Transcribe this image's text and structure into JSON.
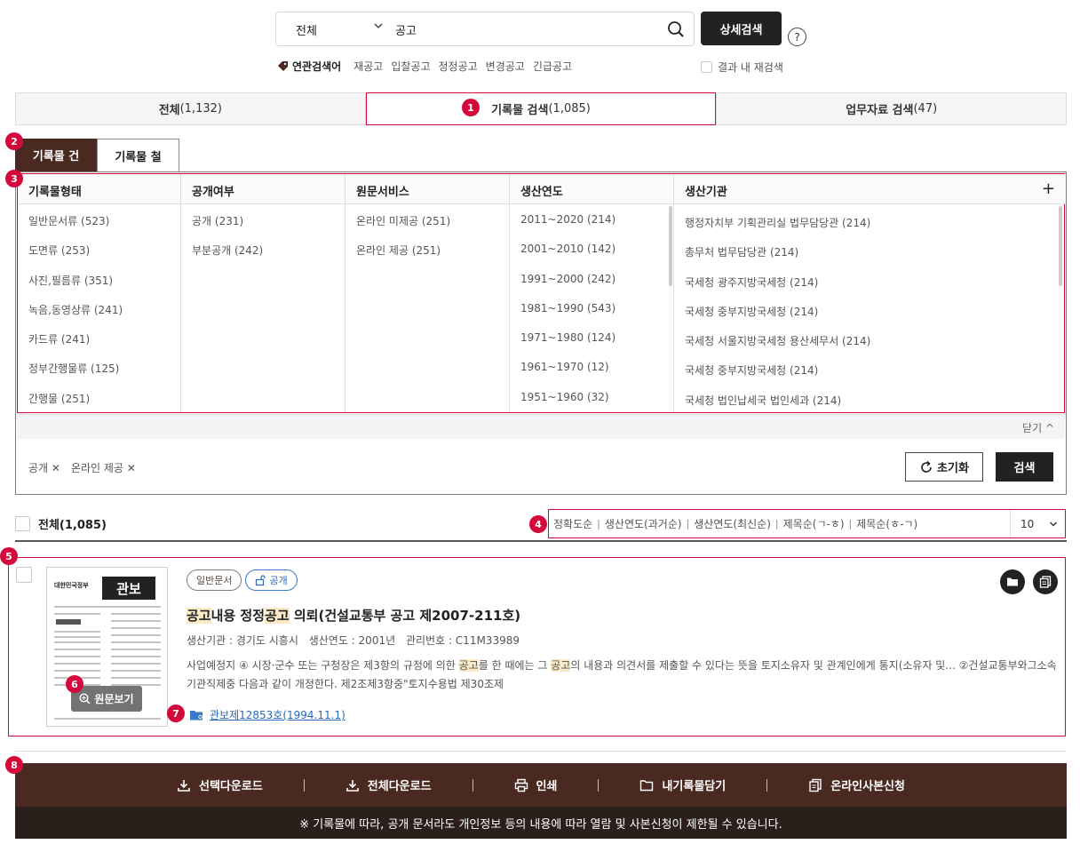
{
  "search": {
    "scope": "전체",
    "query": "공고",
    "advanced_label": "상세검색",
    "help_label": "?"
  },
  "related": {
    "label": "연관검색어",
    "keywords": [
      "재공고",
      "입찰공고",
      "정정공고",
      "변경공고",
      "긴급공고"
    ],
    "within_label": "결과 내 재검색"
  },
  "tabs": [
    {
      "label": "전체",
      "count": "(1,132)"
    },
    {
      "label": "기록물 검색",
      "count": "(1,085)"
    },
    {
      "label": "업무자료 검색",
      "count": "(47)"
    }
  ],
  "subtabs": [
    "기록물 건",
    "기록물 철"
  ],
  "markers": [
    "1",
    "2",
    "3",
    "4",
    "5",
    "6",
    "7",
    "8"
  ],
  "filters": {
    "columns": [
      {
        "header": "기록물형태",
        "items": [
          "일반문서류 (523)",
          "도면류 (253)",
          "사진,필름류 (351)",
          "녹음,동영상류 (241)",
          "카드류 (241)",
          "정부간행물류 (125)",
          "간행물 (251)"
        ]
      },
      {
        "header": "공개여부",
        "items": [
          "공개 (231)",
          "부분공개 (242)"
        ]
      },
      {
        "header": "원문서비스",
        "items": [
          "온라인 미제공 (251)",
          "온라인 제공 (251)"
        ]
      },
      {
        "header": "생산연도",
        "items": [
          "2011~2020 (214)",
          "2001~2010 (142)",
          "1991~2000 (242)",
          "1981~1990 (543)",
          "1971~1980 (124)",
          "1961~1970 (12)",
          "1951~1960 (32)"
        ]
      },
      {
        "header": "생산기관",
        "items": [
          "행정자치부 기획관리실 법무담당관 (214)",
          "총무처 법무담당관 (214)",
          "국세청 광주지방국세청 (214)",
          "국세청 중부지방국세청 (214)",
          "국세청 서울지방국세청 용산세무서 (214)",
          "국세청 중부지방국세청 (214)",
          "국세청 법인납세국 법인세과 (214)"
        ]
      }
    ],
    "plus": "+",
    "close_label": "닫기 ^",
    "chips": [
      "공개 ✕",
      "온라인 제공 ✕"
    ],
    "reset_label": "초기화",
    "search_label": "검색"
  },
  "results_header": {
    "all_label": "전체(1,085)",
    "sorts": [
      "정확도순",
      "생산연도(과거순)",
      "생산연도(최신순)",
      "제목순(ㄱ-ㅎ)",
      "제목순(ㅎ-ㄱ)"
    ],
    "page_size": "10"
  },
  "result": {
    "badge_type": "일반문서",
    "badge_open": "공개",
    "title": {
      "hl1": "공고",
      "t1": "내용 정정",
      "hl2": "공고",
      "t2": " 의뢰(건설교통부 공고 제2007-211호)"
    },
    "meta": {
      "agency": "생산기관 : 경기도 시흥시",
      "year": "생산연도 : 2001년",
      "id": "관리번호 : C11M33989"
    },
    "desc": {
      "d1": "사업예정지 ④ 시장·군수 또는 구청장은 제3항의 규정에 의한 ",
      "hl1": "공고",
      "d2": "를 한 때에는 그 ",
      "hl2": "공고",
      "d3": "의 내용과 의견서를 제출할 수 있다는 뜻을 토지소유자 및 관계인에게 통지(소유자 및... ②건설교통부와그소속기관직제중 다음과 같이 개정한다. 제2조제3항중\"토지수용법 제30조제"
    },
    "view_label": "원문보기",
    "link": "관보제12853호(1994.11.1)",
    "thumb_title": "대한민국정부",
    "thumb_logo": "관보"
  },
  "footer": {
    "buttons": [
      "선택다운로드",
      "전체다운로드",
      "인쇄",
      "내기록물담기",
      "온라인사본신청"
    ],
    "notice": "※ 기록물에 따라, 공개 문서라도 개인정보 등의 내용에 따라 열람 및 사본신청이 제한될 수 있습니다."
  },
  "colors": {
    "accent": "#d4083a",
    "brown": "#4a2a20",
    "dark": "#222222"
  }
}
